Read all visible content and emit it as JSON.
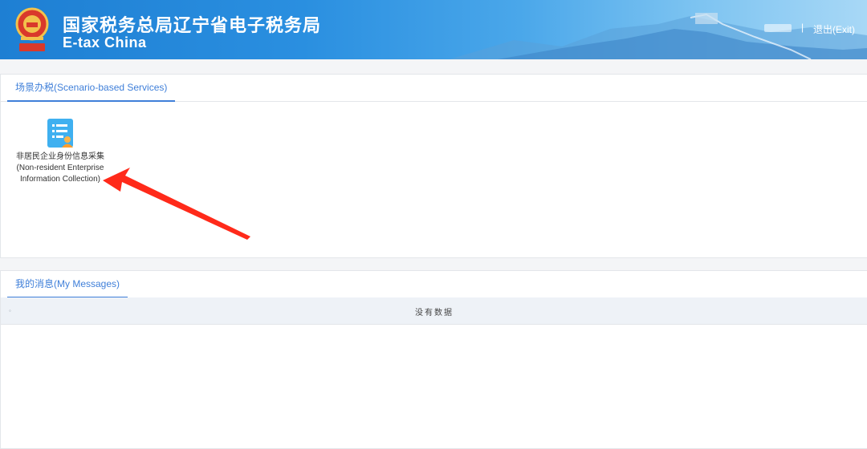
{
  "header": {
    "title_cn": "国家税务总局辽宁省电子税务局",
    "title_en": "E-tax China",
    "separator": "|",
    "exit_label": "退出(Exit)",
    "colors": {
      "bg_start": "#1e7fd3",
      "bg_end": "#a8d8f6",
      "text": "#ffffff"
    }
  },
  "scenario": {
    "tab_label": "场景办税(Scenario-based Services)",
    "services": [
      {
        "icon": "document-person-icon",
        "label": "非居民企业身份信息采集\n(Non-resident Enterprise Information Collection)"
      }
    ]
  },
  "messages": {
    "tab_label": "我的消息(My Messages)",
    "header_marker": "◦",
    "empty_text": "没有数据"
  },
  "accent_color": "#3f7fd9"
}
